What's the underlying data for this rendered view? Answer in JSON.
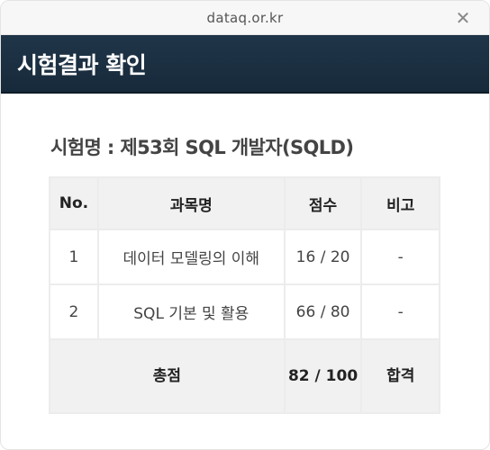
{
  "window": {
    "url": "dataq.or.kr",
    "close_glyph": "✕"
  },
  "header": {
    "title": "시험결과 확인"
  },
  "exam": {
    "title": "시험명 : 제53회 SQL 개발자(SQLD)"
  },
  "table": {
    "headers": {
      "no": "No.",
      "subject": "과목명",
      "score": "점수",
      "note": "비고"
    },
    "rows": [
      {
        "no": "1",
        "subject": "데이터 모델링의 이해",
        "score": "16 / 20",
        "note": "-"
      },
      {
        "no": "2",
        "subject": "SQL 기본 및 활용",
        "score": "66 / 80",
        "note": "-"
      }
    ],
    "total": {
      "label": "총점",
      "score": "82 / 100",
      "result": "합격"
    }
  }
}
